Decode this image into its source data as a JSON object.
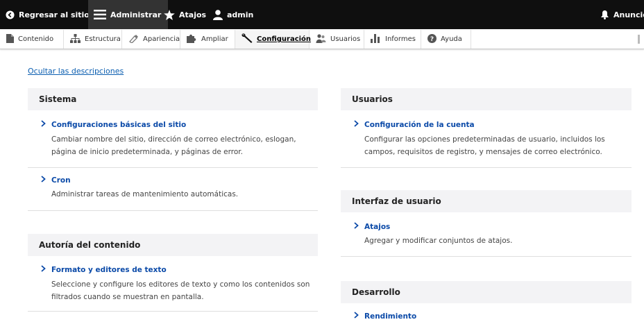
{
  "toolbar": {
    "back_label": "Regresar al sitio",
    "manage_label": "Administrar",
    "shortcuts_label": "Atajos",
    "user_label": "admin",
    "announcements_label": "Anuncios"
  },
  "tray": {
    "items": [
      {
        "label": "Contenido"
      },
      {
        "label": "Estructura"
      },
      {
        "label": "Apariencia"
      },
      {
        "label": "Ampliar"
      },
      {
        "label": "Configuración",
        "active": true
      },
      {
        "label": "Usuarios"
      },
      {
        "label": "Informes"
      },
      {
        "label": "Ayuda"
      }
    ]
  },
  "page": {
    "hide_descriptions": "Ocultar las descripciones"
  },
  "left": {
    "sistema": {
      "title": "Sistema",
      "entries": [
        {
          "title": "Configuraciones básicas del sitio",
          "desc1": "Cambiar nombre del sitio, dirección de correo electrónico, eslogan,",
          "desc2": "página de inicio predeterminada, y páginas de error."
        },
        {
          "title": "Cron",
          "desc1": "Administrar tareas de mantenimiento automáticas."
        }
      ]
    },
    "autoria": {
      "title": "Autoría del contenido",
      "entries": [
        {
          "title": "Formato y editores de texto",
          "desc1": "Seleccione y configure los editores de texto y como los contenidos son",
          "desc2": "filtrados cuando se muestran en pantalla."
        }
      ]
    }
  },
  "right": {
    "usuarios": {
      "title": "Usuarios",
      "entries": [
        {
          "title": "Configuración de la cuenta",
          "desc1": "Configurar las opciones predeterminadas de usuario, incluidos los",
          "desc2": "campos, requisitos de registro, y mensajes de correo electrónico."
        }
      ]
    },
    "interfaz": {
      "title": "Interfaz de usuario",
      "entries": [
        {
          "title": "Atajos",
          "desc1": "Agregar y modificar conjuntos de atajos."
        }
      ]
    },
    "desarrollo": {
      "title": "Desarrollo",
      "entries": [
        {
          "title": "Rendimiento"
        }
      ]
    }
  }
}
